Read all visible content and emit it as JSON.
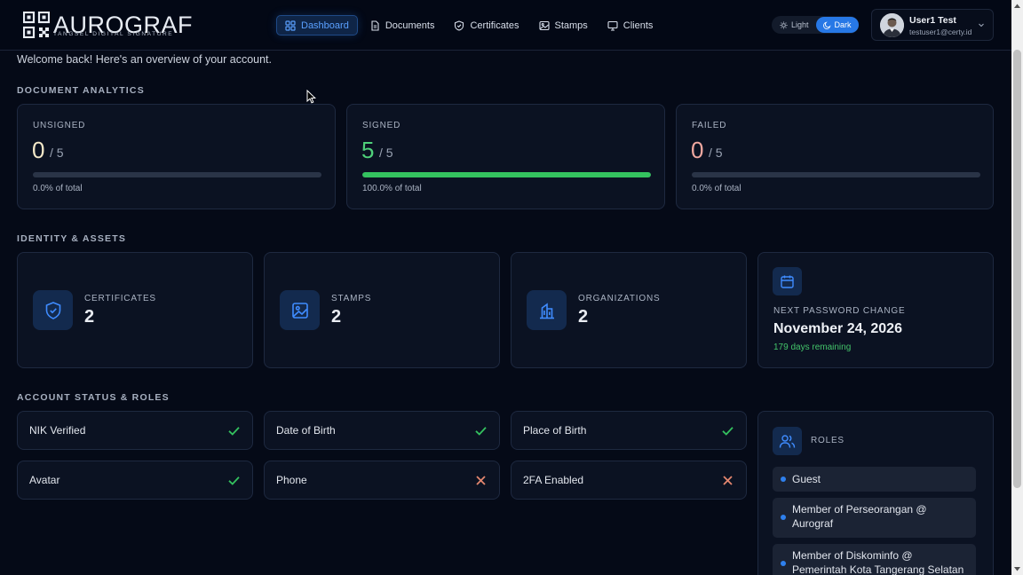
{
  "brand": {
    "name": "AUROGRAF",
    "tagline": "TANGSEL DIGITAL SIGNATURE"
  },
  "nav": [
    {
      "label": "Dashboard",
      "icon": "grid-icon",
      "active": true
    },
    {
      "label": "Documents",
      "icon": "document-icon",
      "active": false
    },
    {
      "label": "Certificates",
      "icon": "shield-icon",
      "active": false
    },
    {
      "label": "Stamps",
      "icon": "image-icon",
      "active": false
    },
    {
      "label": "Clients",
      "icon": "monitor-icon",
      "active": false
    }
  ],
  "theme": {
    "light_label": "Light",
    "dark_label": "Dark",
    "selected": "Dark"
  },
  "user": {
    "name": "User1 Test",
    "email": "testuser1@certy.id"
  },
  "welcome": "Welcome back! Here's an overview of your account.",
  "analytics": {
    "title": "DOCUMENT ANALYTICS",
    "cards": [
      {
        "label": "UNSIGNED",
        "value": "0",
        "total": "/ 5",
        "fraction": 0,
        "pct_text": "0.0% of total",
        "color": "#f3e7c8"
      },
      {
        "label": "SIGNED",
        "value": "5",
        "total": "/ 5",
        "fraction": 1,
        "pct_text": "100.0% of total",
        "color": "#4fd07a"
      },
      {
        "label": "FAILED",
        "value": "0",
        "total": "/ 5",
        "fraction": 0,
        "pct_text": "0.0% of total",
        "color": "#f0a8a0"
      }
    ]
  },
  "identity": {
    "title": "IDENTITY & ASSETS",
    "assets": [
      {
        "label": "CERTIFICATES",
        "value": "2",
        "icon": "shield-icon"
      },
      {
        "label": "STAMPS",
        "value": "2",
        "icon": "image-icon"
      },
      {
        "label": "ORGANIZATIONS",
        "value": "2",
        "icon": "building-icon"
      }
    ],
    "password": {
      "label": "NEXT PASSWORD CHANGE",
      "date": "November 24, 2026",
      "remaining": "179 days remaining",
      "icon": "calendar-icon"
    }
  },
  "account": {
    "title": "ACCOUNT STATUS & ROLES",
    "statuses": [
      {
        "label": "NIK Verified",
        "ok": true
      },
      {
        "label": "Date of Birth",
        "ok": true
      },
      {
        "label": "Place of Birth",
        "ok": true
      },
      {
        "label": "Avatar",
        "ok": true
      },
      {
        "label": "Phone",
        "ok": false
      },
      {
        "label": "2FA Enabled",
        "ok": false
      }
    ],
    "roles_title": "ROLES",
    "roles": [
      "Guest",
      "Member of Perseorangan @ Aurograf",
      "Member of Diskominfo @ Pemerintah Kota Tangerang Selatan"
    ]
  },
  "colors": {
    "accent": "#2778e6",
    "success": "#34c25f",
    "error": "#e3866f"
  }
}
